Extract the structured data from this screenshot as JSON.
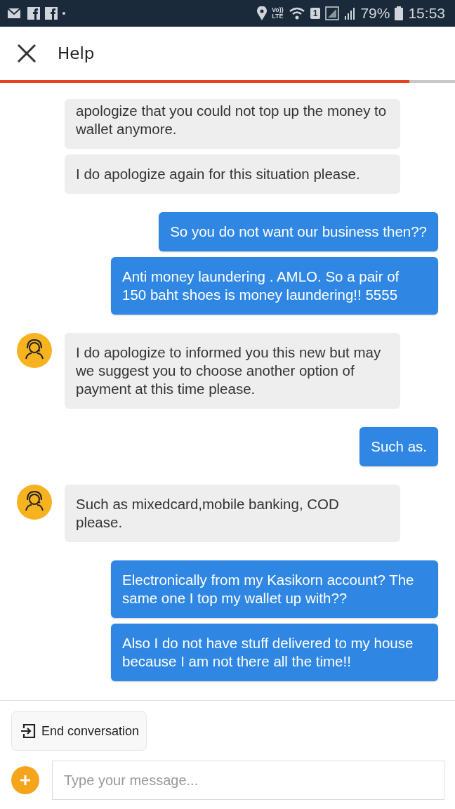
{
  "status_bar": {
    "network": "Vo))\nLTE",
    "sim": "1",
    "battery": "79%",
    "time": "15:53"
  },
  "header": {
    "title": "Help",
    "progress": {
      "level": 0.9
    }
  },
  "messages": [
    {
      "kind": "received",
      "avatar": false,
      "text": "apologize that you could not top up the money to wallet anymore."
    },
    {
      "kind": "received",
      "avatar": false,
      "text": "I do apologize again for this situation please."
    },
    {
      "kind": "sent",
      "text": "So you do not want our business then??"
    },
    {
      "kind": "sent",
      "text": "Anti money laundering . AMLO. So a pair of 150 baht shoes is money laundering!! 5555"
    },
    {
      "kind": "received",
      "avatar": true,
      "text": "I do apologize to informed you this new but may we suggest you to choose another option of payment at this time please."
    },
    {
      "kind": "sent",
      "text": "Such as."
    },
    {
      "kind": "received",
      "avatar": true,
      "text": "Such as mixedcard,mobile banking, COD please."
    },
    {
      "kind": "sent",
      "text": "Electronically from my Kasikorn account? The same one I top my wallet up with??"
    },
    {
      "kind": "sent",
      "text": "Also I do not have stuff delivered to my house because I am not there all the time!!"
    }
  ],
  "end_button": {
    "label": "End conversation"
  },
  "composer": {
    "placeholder": "Type your message..."
  }
}
